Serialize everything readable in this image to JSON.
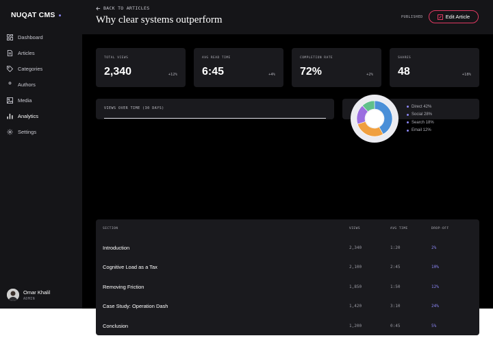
{
  "brand": {
    "name": "NUQAT CMS"
  },
  "nav": [
    {
      "label": "Dashboard",
      "icon": "dashboard-icon"
    },
    {
      "label": "Articles",
      "icon": "document-icon"
    },
    {
      "label": "Categories",
      "icon": "tag-icon"
    },
    {
      "label": "Authors",
      "icon": "user-icon"
    },
    {
      "label": "Media",
      "icon": "image-icon"
    },
    {
      "label": "Analytics",
      "icon": "bar-chart-icon",
      "active": true
    },
    {
      "label": "Settings",
      "icon": "gear-icon"
    }
  ],
  "user": {
    "name": "Omar Khalil",
    "role": "ADMIN"
  },
  "header": {
    "back_label": "BACK TO ARTICLES",
    "title": "Why clear systems outperform",
    "status": "PUBLISHED",
    "edit_label": "Edit Article"
  },
  "stats": [
    {
      "label": "TOTAL VIEWS",
      "value": "2,340",
      "delta": "+12%"
    },
    {
      "label": "AVG READ TIME",
      "value": "6:45",
      "delta": "+4%"
    },
    {
      "label": "COMPLETION RATE",
      "value": "72%",
      "delta": "+2%"
    },
    {
      "label": "SHARES",
      "value": "48",
      "delta": "+18%"
    }
  ],
  "views_chart": {
    "label": "VIEWS OVER TIME (30 DAYS)"
  },
  "chart_data": {
    "type": "pie",
    "categories": [
      "Direct",
      "Social",
      "Search",
      "Email"
    ],
    "values": [
      42,
      28,
      18,
      12
    ],
    "colors": [
      "#4a8fd8",
      "#f0a040",
      "#9b6fe0",
      "#5fc08a"
    ]
  },
  "traffic_legend": [
    "Direct 42%",
    "Social 28%",
    "Search 18%",
    "Email 12%"
  ],
  "table": {
    "headers": {
      "section": "SECTION",
      "views": "VIEWS",
      "avg_time": "AVG TIME",
      "drop_off": "DROP-OFF"
    },
    "rows": [
      {
        "section": "Introduction",
        "views": "2,340",
        "avg_time": "1:20",
        "drop_off": "2%"
      },
      {
        "section": "Cognitive Load as a Tax",
        "views": "2,100",
        "avg_time": "2:45",
        "drop_off": "10%"
      },
      {
        "section": "Removing Friction",
        "views": "1,850",
        "avg_time": "1:50",
        "drop_off": "12%"
      },
      {
        "section": "Case Study: Operation Dash",
        "views": "1,420",
        "avg_time": "3:10",
        "drop_off": "24%"
      },
      {
        "section": "Conclusion",
        "views": "1,200",
        "avg_time": "0:45",
        "drop_off": "5%"
      }
    ]
  },
  "colors": {
    "accent": "#8b86f5",
    "edit_border": "#e23a63",
    "surface": "#1a1a1e",
    "sidebar": "#151518"
  }
}
